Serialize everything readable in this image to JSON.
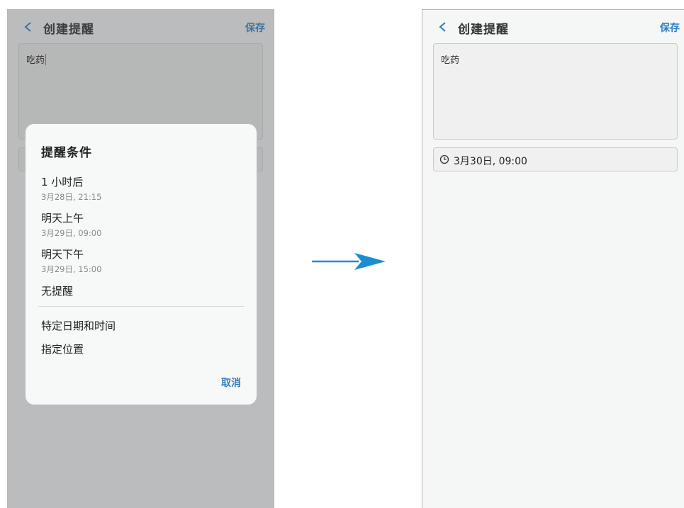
{
  "left_screen": {
    "title": "创建提醒",
    "save_label": "保存",
    "memo_text": "吃药",
    "dialog": {
      "title": "提醒条件",
      "options": [
        {
          "label": "1 小时后",
          "sub": "3月28日, 21:15"
        },
        {
          "label": "明天上午",
          "sub": "3月29日, 09:00"
        },
        {
          "label": "明天下午",
          "sub": "3月29日, 15:00"
        },
        {
          "label": "无提醒"
        },
        {
          "label": "特定日期和时间"
        },
        {
          "label": "指定位置"
        }
      ],
      "cancel_label": "取消"
    }
  },
  "right_screen": {
    "title": "创建提醒",
    "save_label": "保存",
    "memo_text": "吃药",
    "condition_text": "3月30日, 09:00"
  },
  "colors": {
    "accent": "#2d7cc3",
    "arrow": "#1a8ed1",
    "dim_overlay": "#bbbcbd"
  },
  "icons": [
    "back-arrow-icon",
    "clock-icon",
    "arrow-right-icon"
  ]
}
